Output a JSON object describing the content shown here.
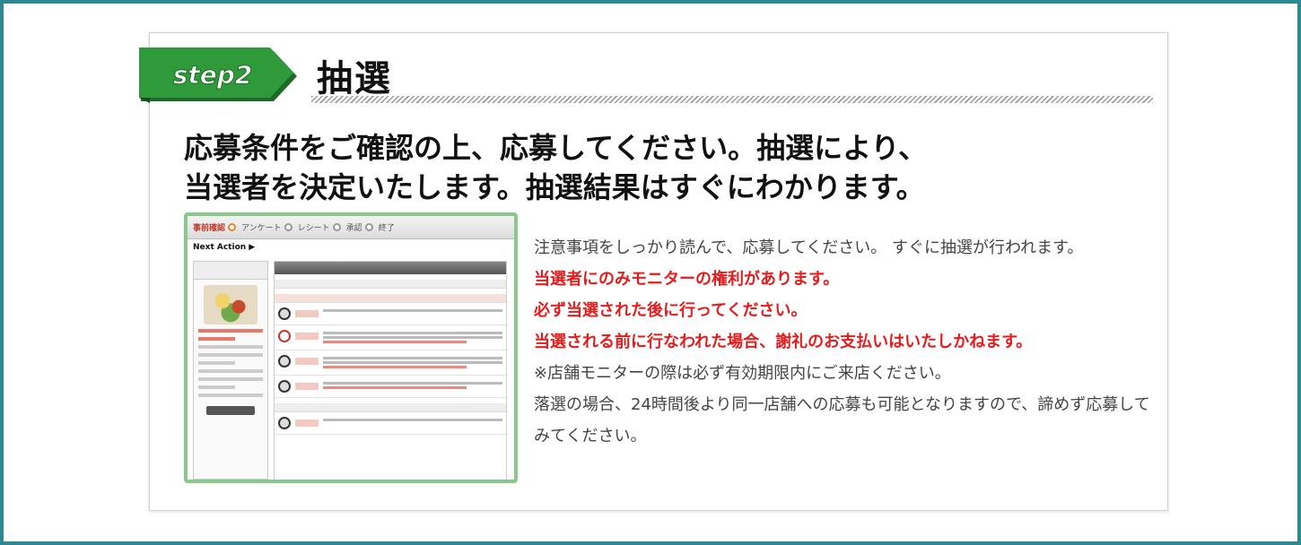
{
  "step": {
    "badge_label": "step2",
    "title": "抽選"
  },
  "lead": {
    "line1": "応募条件をご確認の上、応募してください。抽選により、",
    "line2": "当選者を決定いたします。抽選結果はすぐにわかります。"
  },
  "screenshot_preview": {
    "steps": [
      "事前確認",
      "アンケート",
      "レシート",
      "承認",
      "終了"
    ],
    "next_action": "Next Action ▶"
  },
  "notes": {
    "intro": "注意事項をしっかり読んで、応募してください。 すぐに抽選が行われます。",
    "warning1": "当選者にのみモニターの権利があります。",
    "warning2": "必ず当選された後に行ってください。",
    "warning3": "当選される前に行なわれた場合、謝礼のお支払いはいたしかねます。",
    "note1": "※店舗モニターの際は必ず有効期限内にご来店ください。",
    "note2": "落選の場合、24時間後より同一店舗への応募も可能となりますので、諦めず応募してみてください。"
  },
  "colors": {
    "frame_border": "#2e8894",
    "badge_green": "#2f9a3a",
    "warning_red": "#e51c1c",
    "preview_border": "#8bc88b"
  }
}
